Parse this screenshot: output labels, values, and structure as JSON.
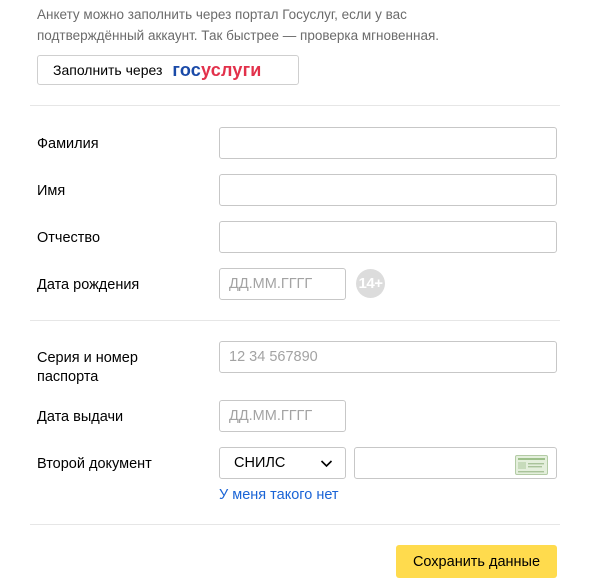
{
  "intro_text": "Анкету можно заполнить через портал Госуслуг, если у вас подтверждённый аккаунт. Так быстрее — проверка мгновенная.",
  "gosuslugi_button": {
    "prefix": "Заполнить через",
    "logo_part1": "гос",
    "logo_part2": "услуги"
  },
  "personal": {
    "last_name_label": "Фамилия",
    "first_name_label": "Имя",
    "patronymic_label": "Отчество",
    "birth_date_label": "Дата рождения",
    "birth_date_placeholder": "ДД.ММ.ГГГГ",
    "age_badge": "14+"
  },
  "passport": {
    "number_label_line1": "Серия и номер",
    "number_label_line2": "паспорта",
    "number_placeholder": "12 34 567890",
    "issue_date_label": "Дата выдачи",
    "issue_date_placeholder": "ДД.ММ.ГГГГ",
    "second_doc_label": "Второй документ",
    "second_doc_selected": "СНИЛС",
    "no_doc_link": "У меня такого нет"
  },
  "save_button": "Сохранить данные",
  "colors": {
    "accent_yellow": "#ffdb4d",
    "link_blue": "#1a64d6",
    "gos_blue": "#1a4aa8",
    "gos_red": "#e2314b"
  }
}
